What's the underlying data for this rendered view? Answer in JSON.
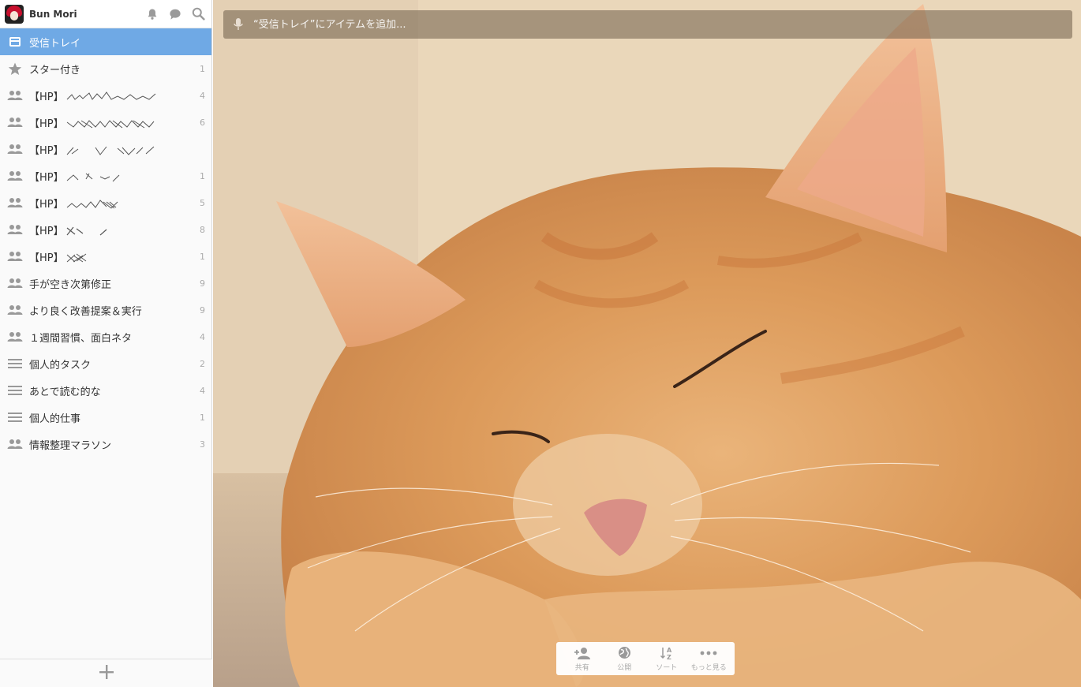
{
  "user": {
    "name": "Bun Mori"
  },
  "header_icons": [
    "bell-icon",
    "chat-bubble-icon",
    "search-icon"
  ],
  "lists": [
    {
      "label": "受信トレイ",
      "icon": "inbox-icon",
      "count": "",
      "selected": true
    },
    {
      "label": "スター付き",
      "icon": "star-icon",
      "count": "1"
    },
    {
      "label": "【HP】",
      "icon": "people-icon",
      "count": "4",
      "redacted": true
    },
    {
      "label": "【HP】",
      "icon": "people-icon",
      "count": "6",
      "redacted": true
    },
    {
      "label": "【HP】",
      "icon": "people-icon",
      "count": "",
      "redacted": true
    },
    {
      "label": "【HP】",
      "icon": "people-icon",
      "count": "1",
      "redacted": true
    },
    {
      "label": "【HP】",
      "icon": "people-icon",
      "count": "5",
      "redacted": true
    },
    {
      "label": "【HP】",
      "icon": "people-icon",
      "count": "8",
      "redacted": true
    },
    {
      "label": "【HP】",
      "icon": "people-icon",
      "count": "1",
      "redacted": true
    },
    {
      "label": "手が空き次第修正",
      "icon": "people-icon",
      "count": "9"
    },
    {
      "label": "より良く改善提案＆実行",
      "icon": "people-icon",
      "count": "9"
    },
    {
      "label": "１週間習慣、面白ネタ",
      "icon": "people-icon",
      "count": "4"
    },
    {
      "label": "個人的タスク",
      "icon": "list-icon",
      "count": "2"
    },
    {
      "label": "あとで読む的な",
      "icon": "list-icon",
      "count": "4"
    },
    {
      "label": "個人的仕事",
      "icon": "list-icon",
      "count": "1"
    },
    {
      "label": "情報整理マラソン",
      "icon": "people-icon",
      "count": "3"
    }
  ],
  "add_item": {
    "placeholder": "“受信トレイ”にアイテムを追加..."
  },
  "toolbar": {
    "share": "共有",
    "publish": "公開",
    "sort": "ソート",
    "more": "もっと見る"
  },
  "colors": {
    "accent": "#6fa9e5",
    "sidebar_bg": "#fafafa"
  }
}
